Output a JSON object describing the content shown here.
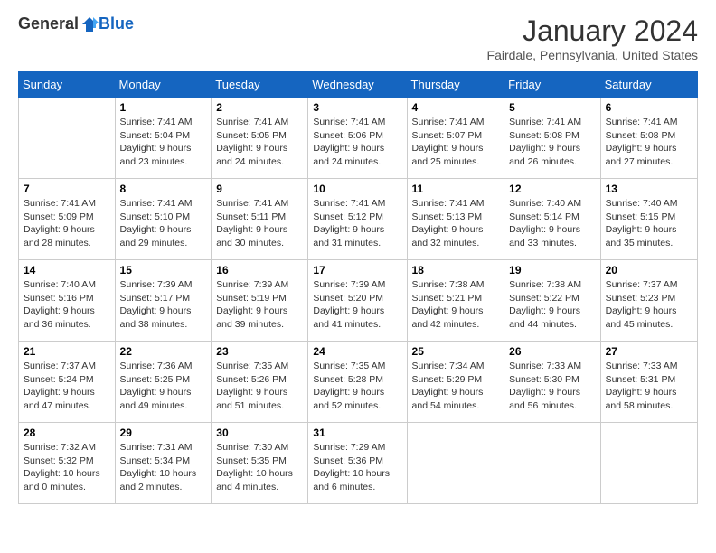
{
  "header": {
    "logo": {
      "general": "General",
      "blue": "Blue"
    },
    "title": "January 2024",
    "location": "Fairdale, Pennsylvania, United States"
  },
  "calendar": {
    "days_of_week": [
      "Sunday",
      "Monday",
      "Tuesday",
      "Wednesday",
      "Thursday",
      "Friday",
      "Saturday"
    ],
    "weeks": [
      [
        {
          "day": "",
          "sunrise": "",
          "sunset": "",
          "daylight": "",
          "empty": true
        },
        {
          "day": "1",
          "sunrise": "Sunrise: 7:41 AM",
          "sunset": "Sunset: 5:04 PM",
          "daylight": "Daylight: 9 hours and 23 minutes."
        },
        {
          "day": "2",
          "sunrise": "Sunrise: 7:41 AM",
          "sunset": "Sunset: 5:05 PM",
          "daylight": "Daylight: 9 hours and 24 minutes."
        },
        {
          "day": "3",
          "sunrise": "Sunrise: 7:41 AM",
          "sunset": "Sunset: 5:06 PM",
          "daylight": "Daylight: 9 hours and 24 minutes."
        },
        {
          "day": "4",
          "sunrise": "Sunrise: 7:41 AM",
          "sunset": "Sunset: 5:07 PM",
          "daylight": "Daylight: 9 hours and 25 minutes."
        },
        {
          "day": "5",
          "sunrise": "Sunrise: 7:41 AM",
          "sunset": "Sunset: 5:08 PM",
          "daylight": "Daylight: 9 hours and 26 minutes."
        },
        {
          "day": "6",
          "sunrise": "Sunrise: 7:41 AM",
          "sunset": "Sunset: 5:08 PM",
          "daylight": "Daylight: 9 hours and 27 minutes."
        }
      ],
      [
        {
          "day": "7",
          "sunrise": "Sunrise: 7:41 AM",
          "sunset": "Sunset: 5:09 PM",
          "daylight": "Daylight: 9 hours and 28 minutes."
        },
        {
          "day": "8",
          "sunrise": "Sunrise: 7:41 AM",
          "sunset": "Sunset: 5:10 PM",
          "daylight": "Daylight: 9 hours and 29 minutes."
        },
        {
          "day": "9",
          "sunrise": "Sunrise: 7:41 AM",
          "sunset": "Sunset: 5:11 PM",
          "daylight": "Daylight: 9 hours and 30 minutes."
        },
        {
          "day": "10",
          "sunrise": "Sunrise: 7:41 AM",
          "sunset": "Sunset: 5:12 PM",
          "daylight": "Daylight: 9 hours and 31 minutes."
        },
        {
          "day": "11",
          "sunrise": "Sunrise: 7:41 AM",
          "sunset": "Sunset: 5:13 PM",
          "daylight": "Daylight: 9 hours and 32 minutes."
        },
        {
          "day": "12",
          "sunrise": "Sunrise: 7:40 AM",
          "sunset": "Sunset: 5:14 PM",
          "daylight": "Daylight: 9 hours and 33 minutes."
        },
        {
          "day": "13",
          "sunrise": "Sunrise: 7:40 AM",
          "sunset": "Sunset: 5:15 PM",
          "daylight": "Daylight: 9 hours and 35 minutes."
        }
      ],
      [
        {
          "day": "14",
          "sunrise": "Sunrise: 7:40 AM",
          "sunset": "Sunset: 5:16 PM",
          "daylight": "Daylight: 9 hours and 36 minutes."
        },
        {
          "day": "15",
          "sunrise": "Sunrise: 7:39 AM",
          "sunset": "Sunset: 5:17 PM",
          "daylight": "Daylight: 9 hours and 38 minutes."
        },
        {
          "day": "16",
          "sunrise": "Sunrise: 7:39 AM",
          "sunset": "Sunset: 5:19 PM",
          "daylight": "Daylight: 9 hours and 39 minutes."
        },
        {
          "day": "17",
          "sunrise": "Sunrise: 7:39 AM",
          "sunset": "Sunset: 5:20 PM",
          "daylight": "Daylight: 9 hours and 41 minutes."
        },
        {
          "day": "18",
          "sunrise": "Sunrise: 7:38 AM",
          "sunset": "Sunset: 5:21 PM",
          "daylight": "Daylight: 9 hours and 42 minutes."
        },
        {
          "day": "19",
          "sunrise": "Sunrise: 7:38 AM",
          "sunset": "Sunset: 5:22 PM",
          "daylight": "Daylight: 9 hours and 44 minutes."
        },
        {
          "day": "20",
          "sunrise": "Sunrise: 7:37 AM",
          "sunset": "Sunset: 5:23 PM",
          "daylight": "Daylight: 9 hours and 45 minutes."
        }
      ],
      [
        {
          "day": "21",
          "sunrise": "Sunrise: 7:37 AM",
          "sunset": "Sunset: 5:24 PM",
          "daylight": "Daylight: 9 hours and 47 minutes."
        },
        {
          "day": "22",
          "sunrise": "Sunrise: 7:36 AM",
          "sunset": "Sunset: 5:25 PM",
          "daylight": "Daylight: 9 hours and 49 minutes."
        },
        {
          "day": "23",
          "sunrise": "Sunrise: 7:35 AM",
          "sunset": "Sunset: 5:26 PM",
          "daylight": "Daylight: 9 hours and 51 minutes."
        },
        {
          "day": "24",
          "sunrise": "Sunrise: 7:35 AM",
          "sunset": "Sunset: 5:28 PM",
          "daylight": "Daylight: 9 hours and 52 minutes."
        },
        {
          "day": "25",
          "sunrise": "Sunrise: 7:34 AM",
          "sunset": "Sunset: 5:29 PM",
          "daylight": "Daylight: 9 hours and 54 minutes."
        },
        {
          "day": "26",
          "sunrise": "Sunrise: 7:33 AM",
          "sunset": "Sunset: 5:30 PM",
          "daylight": "Daylight: 9 hours and 56 minutes."
        },
        {
          "day": "27",
          "sunrise": "Sunrise: 7:33 AM",
          "sunset": "Sunset: 5:31 PM",
          "daylight": "Daylight: 9 hours and 58 minutes."
        }
      ],
      [
        {
          "day": "28",
          "sunrise": "Sunrise: 7:32 AM",
          "sunset": "Sunset: 5:32 PM",
          "daylight": "Daylight: 10 hours and 0 minutes."
        },
        {
          "day": "29",
          "sunrise": "Sunrise: 7:31 AM",
          "sunset": "Sunset: 5:34 PM",
          "daylight": "Daylight: 10 hours and 2 minutes."
        },
        {
          "day": "30",
          "sunrise": "Sunrise: 7:30 AM",
          "sunset": "Sunset: 5:35 PM",
          "daylight": "Daylight: 10 hours and 4 minutes."
        },
        {
          "day": "31",
          "sunrise": "Sunrise: 7:29 AM",
          "sunset": "Sunset: 5:36 PM",
          "daylight": "Daylight: 10 hours and 6 minutes."
        },
        {
          "day": "",
          "sunrise": "",
          "sunset": "",
          "daylight": "",
          "empty": true
        },
        {
          "day": "",
          "sunrise": "",
          "sunset": "",
          "daylight": "",
          "empty": true
        },
        {
          "day": "",
          "sunrise": "",
          "sunset": "",
          "daylight": "",
          "empty": true
        }
      ]
    ]
  }
}
